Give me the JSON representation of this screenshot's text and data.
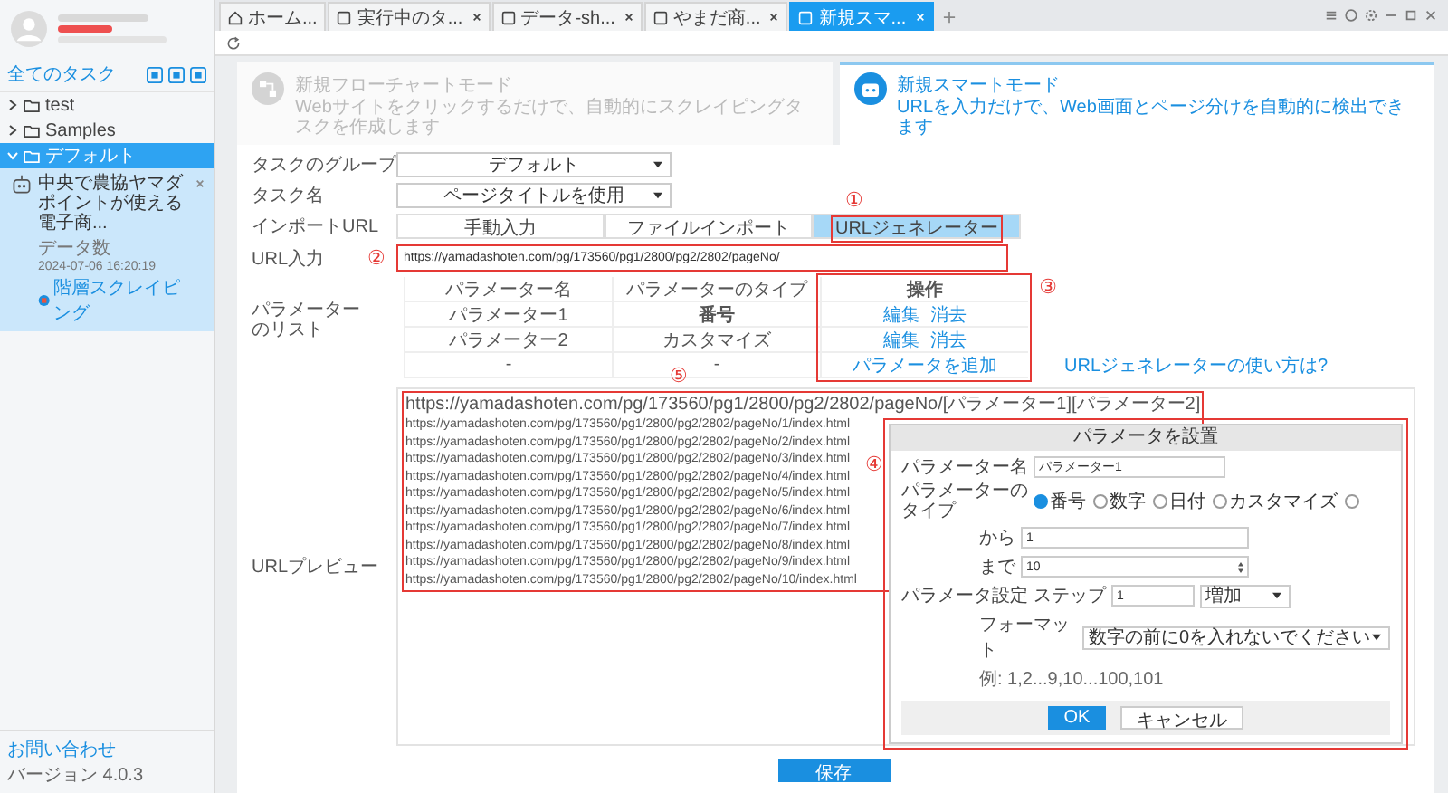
{
  "sidebar": {
    "heading": "全てのタスク",
    "folders": [
      {
        "name": "test",
        "expanded": false,
        "selected": false
      },
      {
        "name": "Samples",
        "expanded": false,
        "selected": false
      },
      {
        "name": "デフォルト",
        "expanded": true,
        "selected": true,
        "tasks": [
          {
            "title": "中央で農協ヤマダポイントが使える電子商...",
            "data_label": "データ数",
            "date": "2024-07-06 16:20:19",
            "mode": "階層スクレイピング",
            "selected": true
          }
        ]
      }
    ],
    "contact": "お問い合わせ",
    "version": "バージョン 4.0.3"
  },
  "tabs": [
    {
      "label": "ホーム...",
      "kind": "home",
      "selected": false
    },
    {
      "label": "実行中のタ...",
      "kind": "page",
      "selected": false
    },
    {
      "label": "データ-sh...",
      "kind": "page",
      "selected": false
    },
    {
      "label": "やまだ商...",
      "kind": "page",
      "selected": false
    },
    {
      "label": "新規スマ...",
      "kind": "page",
      "selected": true
    }
  ],
  "modes": [
    {
      "title": "新規フローチャートモード",
      "description": "Webサイトをクリックするだけで、自動的にスクレイピングタスクを作成します",
      "kind": "flow",
      "selected": false
    },
    {
      "title": "新規スマートモード",
      "description": "URLを入力だけで、Web画面とページ分けを自動的に検出できます",
      "kind": "smart",
      "selected": true
    }
  ],
  "form": {
    "group": {
      "label": "タスクのグループ",
      "value": "デフォルト"
    },
    "name": {
      "label": "タスク名",
      "value": "ページタイトルを使用"
    },
    "import": {
      "label": "インポートURL",
      "options": [
        {
          "label": "手動入力",
          "selected": false
        },
        {
          "label": "ファイルインポート",
          "selected": false
        },
        {
          "label": "URLジェネレーター",
          "selected": true,
          "callout": "①"
        }
      ]
    },
    "url": {
      "label": "URL入力",
      "value": "https://yamadashoten.com/pg/173560/pg1/2800/pg2/2802/pageNo/",
      "callout": "②"
    },
    "params": {
      "label": "パラメーターのリスト",
      "columns": [
        "パラメーター名",
        "パラメーターのタイプ",
        "操作"
      ],
      "callout": "③",
      "rows": [
        {
          "name": "パラメーター1",
          "type": "番号",
          "actions": [
            "編集",
            "消去"
          ]
        },
        {
          "name": "パラメーター2",
          "type": "カスタマイズ",
          "actions": [
            "編集",
            "消去"
          ]
        },
        {
          "name": "-",
          "type": "-",
          "actions": [
            "パラメータを追加"
          ]
        }
      ]
    },
    "help_link": "URLジェネレーターの使い方は?",
    "preview": {
      "label": "URLプレビュー",
      "callout": "⑤",
      "lines": [
        "https://yamadashoten.com/pg/173560/pg1/2800/pg2/2802/pageNo/[パラメーター1][パラメーター2]",
        "https://yamadashoten.com/pg/173560/pg1/2800/pg2/2802/pageNo/1/index.html",
        "https://yamadashoten.com/pg/173560/pg1/2800/pg2/2802/pageNo/2/index.html",
        "https://yamadashoten.com/pg/173560/pg1/2800/pg2/2802/pageNo/3/index.html",
        "https://yamadashoten.com/pg/173560/pg1/2800/pg2/2802/pageNo/4/index.html",
        "https://yamadashoten.com/pg/173560/pg1/2800/pg2/2802/pageNo/5/index.html",
        "https://yamadashoten.com/pg/173560/pg1/2800/pg2/2802/pageNo/6/index.html",
        "https://yamadashoten.com/pg/173560/pg1/2800/pg2/2802/pageNo/7/index.html",
        "https://yamadashoten.com/pg/173560/pg1/2800/pg2/2802/pageNo/8/index.html",
        "https://yamadashoten.com/pg/173560/pg1/2800/pg2/2802/pageNo/9/index.html",
        "https://yamadashoten.com/pg/173560/pg1/2800/pg2/2802/pageNo/10/index.html"
      ]
    }
  },
  "dialog": {
    "title": "パラメータを設置",
    "callout": "④",
    "name": {
      "label": "パラメーター名",
      "value": "パラメーター1"
    },
    "type": {
      "label": "パラメーターのタイプ",
      "options": [
        {
          "label": "番号",
          "selected": true
        },
        {
          "label": "数字",
          "selected": false
        },
        {
          "label": "日付",
          "selected": false
        },
        {
          "label": "カスタマイズ",
          "selected": false
        },
        {
          "selected": false
        }
      ]
    },
    "from": {
      "label": "から",
      "value": "1"
    },
    "to": {
      "label": "まで",
      "value": "10"
    },
    "settings_label": "パラメータ設定",
    "step": {
      "label": "ステップ",
      "value": "1",
      "mode": "増加"
    },
    "format": {
      "label": "フォーマット",
      "value": "数字の前に0を入れないでください"
    },
    "example": "例: 1,2...9,10...100,101",
    "buttons": [
      {
        "label": "OK",
        "kind": "primary"
      },
      {
        "label": "キャンセル",
        "kind": "secondary"
      }
    ]
  },
  "save_button": "保存"
}
